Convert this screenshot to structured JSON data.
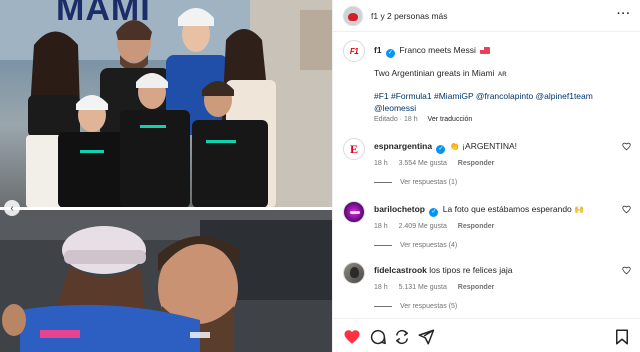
{
  "header": {
    "title": "f1 y 2 personas más",
    "more_icon": "more-horizontal-icon"
  },
  "photo": {
    "banner_text": "MAMI"
  },
  "caption": {
    "username": "f1",
    "title": "Franco meets Messi",
    "flag": "flag-emoji",
    "line2": "Two Argentinian greats in Miami",
    "line2_flag": "AR",
    "tags": "#F1 #Formula1 #MiamiGP @francolapinto @alpinef1team @leomessi",
    "edited": "Editado · 18 h",
    "translate": "Ver traducción"
  },
  "comments": [
    {
      "username": "espnargentina",
      "text": "¡ARGENTINA!",
      "emoji": "👏",
      "time": "18 h",
      "likes": "3.554 Me gusta",
      "reply": "Responder",
      "view_replies": "Ver respuestas (1)",
      "avatar": "espn-logo"
    },
    {
      "username": "barilochetop",
      "text": "La foto que estábamos esperando",
      "emoji": "🙌",
      "time": "18 h",
      "likes": "2.409 Me gusta",
      "reply": "Responder",
      "view_replies": "Ver respuestas (4)",
      "avatar": "bariloche-logo"
    },
    {
      "username": "fidelcastrook",
      "text": "los tipos re felices jaja",
      "emoji": "",
      "time": "18 h",
      "likes": "5.131 Me gusta",
      "reply": "Responder",
      "view_replies": "Ver respuestas (5)",
      "avatar": "fidel-photo"
    }
  ],
  "actions": [
    "heart-icon",
    "comment-icon",
    "share-icon",
    "bookmark-icon"
  ],
  "colors": {
    "like_red": "#ff3040",
    "link_blue": "#00376b",
    "verified_blue": "#0095f6",
    "muted_text": "#737373"
  }
}
